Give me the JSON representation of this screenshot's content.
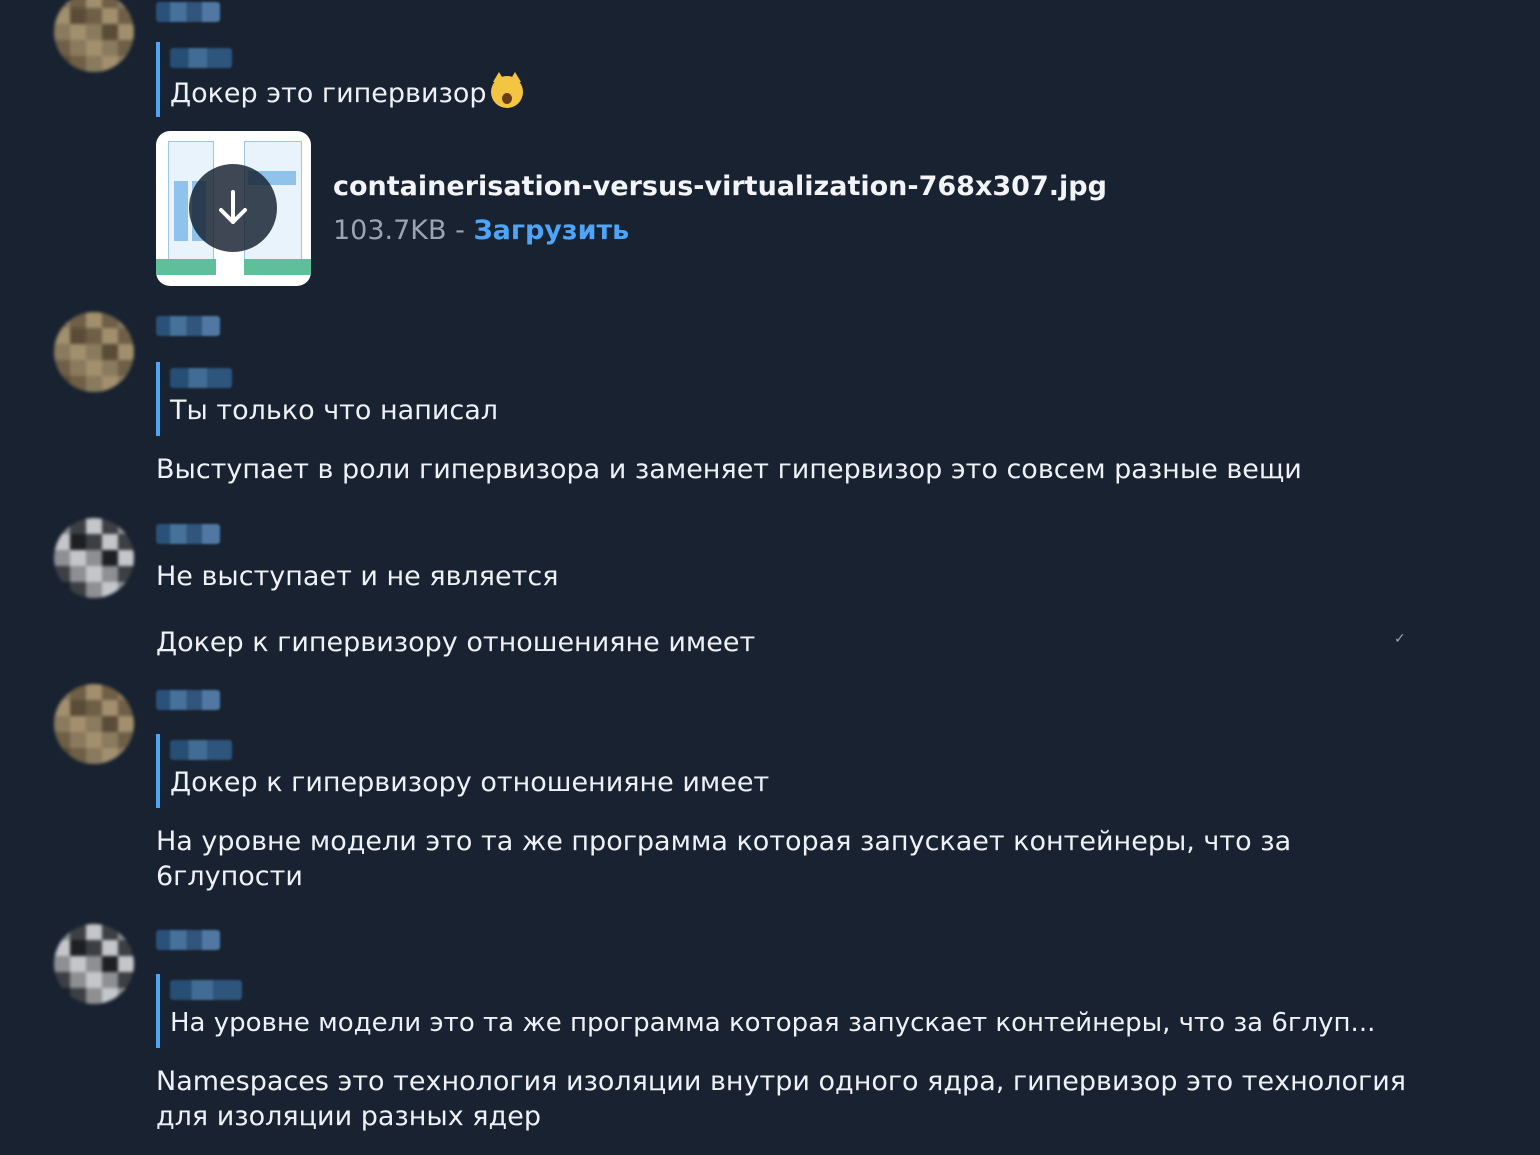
{
  "messages": [
    {
      "quote_text": "Докер это гипервизор",
      "quote_emoji": "scream-cat-emoji",
      "file": {
        "name": "containerisation-versus-virtualization-768x307.jpg",
        "size": "103.7KB",
        "separator": " - ",
        "action": "Загрузить"
      }
    },
    {
      "quote_text": "Ты только что написал",
      "text": "Выступает в роли гипервизора и заменяет гипервизор это совсем разные вещи"
    },
    {
      "text": "Не выступает и не является",
      "text2": "Докер к гипервизору отношенияне имеет"
    },
    {
      "quote_text": "Докер к гипервизору отношенияне имеет",
      "text": "На уровне модели это та же программа которая запускает контейнеры,  что за 6глупости"
    },
    {
      "quote_text": "На уровне модели это та же программа которая запускает контейнеры,  что за 6глуп...",
      "text": "Namespaces это технология изоляции внутри одного ядра, гипервизор это технология для изоляции разных ядер"
    }
  ],
  "icons": {
    "download": "download-arrow-icon",
    "avatar_blurred": "avatar"
  },
  "colors": {
    "background": "#182230",
    "accent": "#4ea4f6",
    "text": "#eef1f5",
    "muted": "#9aa5b3"
  }
}
